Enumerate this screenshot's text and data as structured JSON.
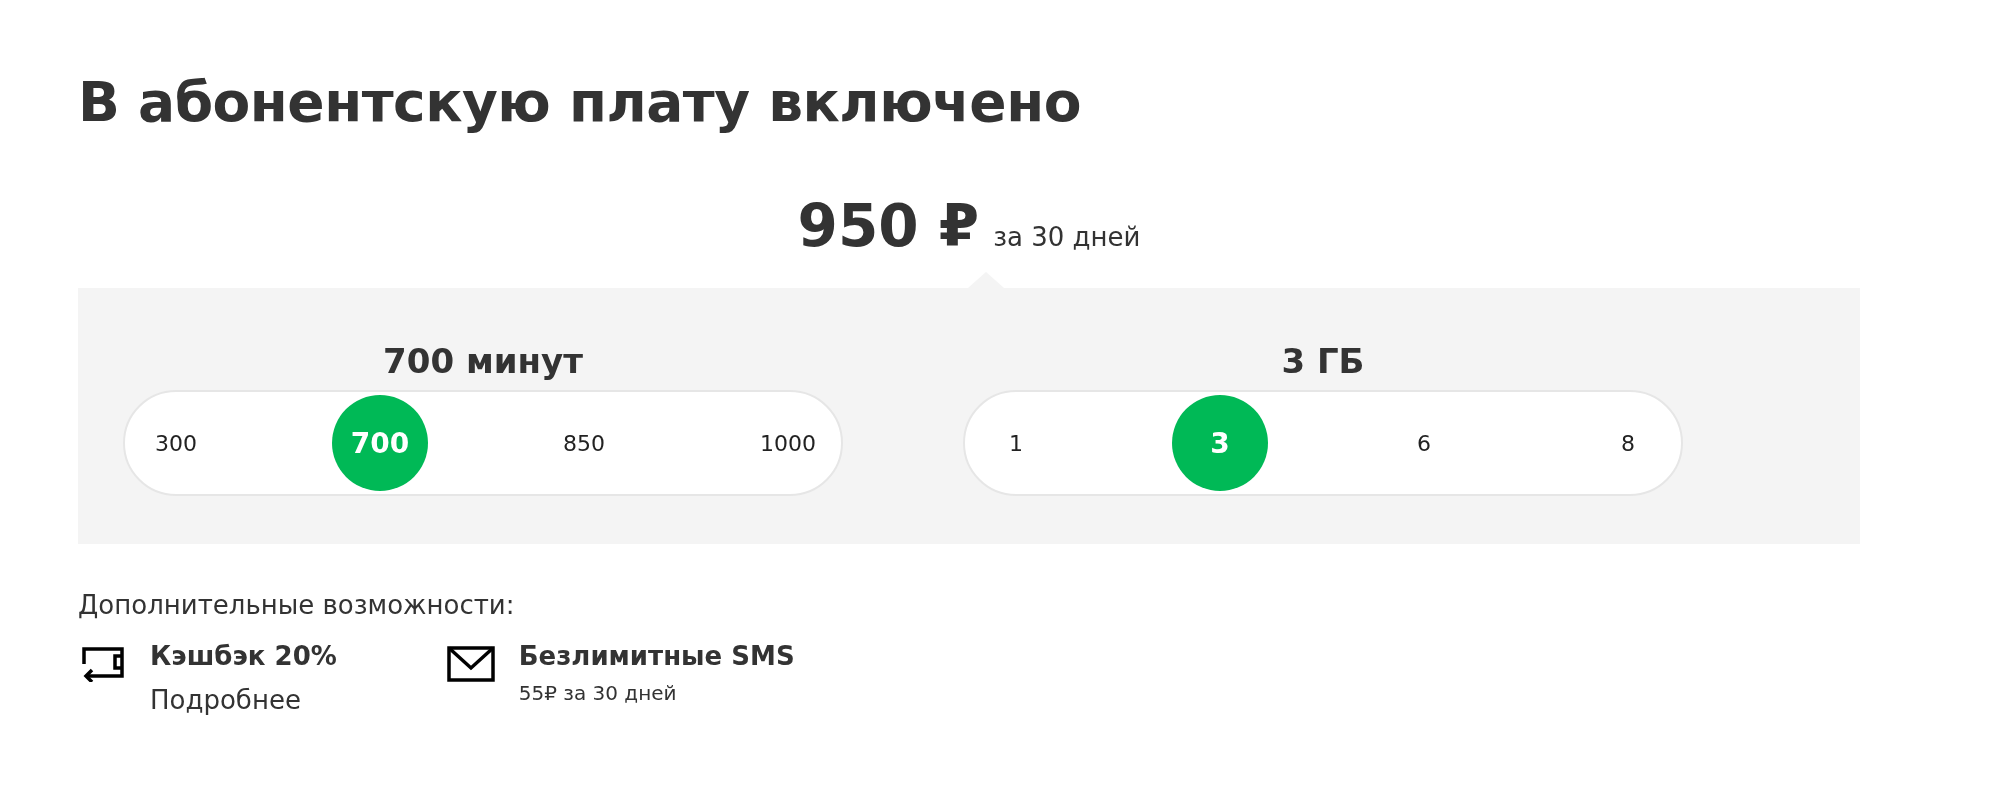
{
  "title": "В абонентскую плату включено",
  "price": {
    "amount": "950 ₽",
    "period": "за 30 дней"
  },
  "selectors": [
    {
      "label": "700 минут",
      "options": [
        {
          "label": "300",
          "selected": false
        },
        {
          "label": "700",
          "selected": true
        },
        {
          "label": "850",
          "selected": false
        },
        {
          "label": "1000",
          "selected": false
        }
      ]
    },
    {
      "label": "3 ГБ",
      "options": [
        {
          "label": "1",
          "selected": false
        },
        {
          "label": "3",
          "selected": true
        },
        {
          "label": "6",
          "selected": false
        },
        {
          "label": "8",
          "selected": false
        }
      ]
    }
  ],
  "extras": {
    "heading": "Дополнительные возможности:",
    "items": [
      {
        "kind": "cashback",
        "title": "Кэшбэк 20%",
        "link": "Подробнее"
      },
      {
        "kind": "sms",
        "title": "Безлимитные SMS",
        "note": "55₽ за 30 дней"
      }
    ]
  }
}
